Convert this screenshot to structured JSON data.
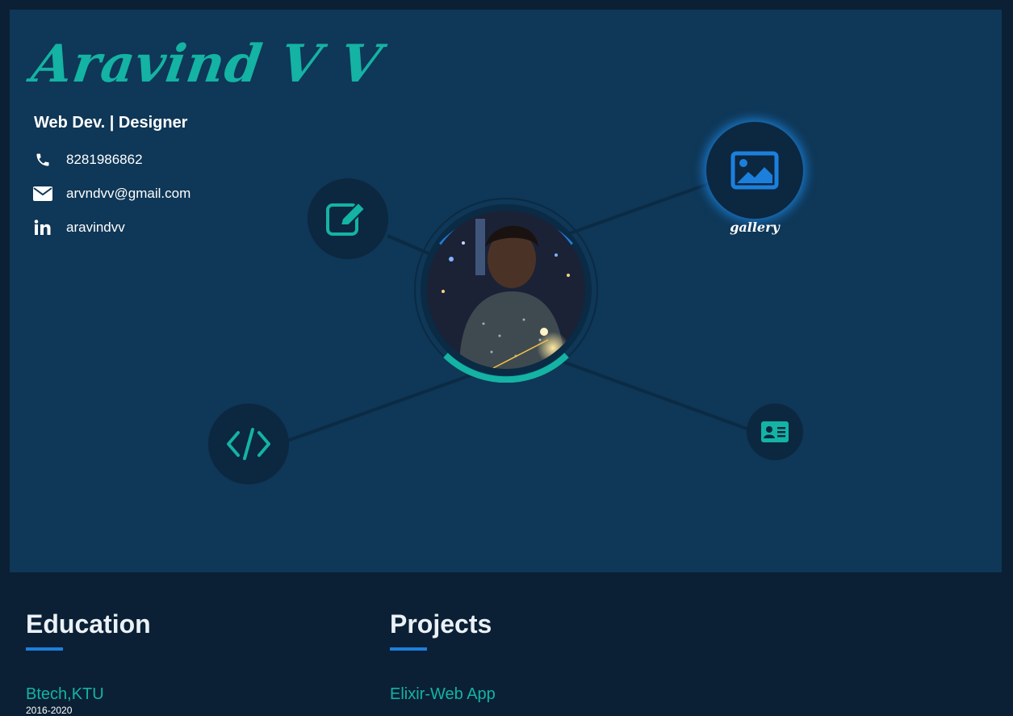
{
  "profile": {
    "name": "Aravind V V",
    "role": "Web Dev. | Designer",
    "phone": "8281986862",
    "email": "arvndvv@gmail.com",
    "linkedin": "aravindvv"
  },
  "nodes": {
    "gallery_label": "gallery"
  },
  "icons": {
    "phone": "phone-icon",
    "email": "envelope-icon",
    "linkedin": "linkedin-icon",
    "edit": "edit-icon",
    "gallery": "image-icon",
    "code": "code-icon",
    "card": "id-card-icon"
  },
  "colors": {
    "hero_bg": "#0f3757",
    "page_bg": "#0b2035",
    "accent_teal": "#14b3a4",
    "accent_blue": "#1c7fdc"
  },
  "sections": {
    "education": {
      "title": "Education",
      "item": "Btech,KTU",
      "sub": "2016-2020"
    },
    "projects": {
      "title": "Projects",
      "item": "Elixir-Web App",
      "sub": ""
    }
  }
}
